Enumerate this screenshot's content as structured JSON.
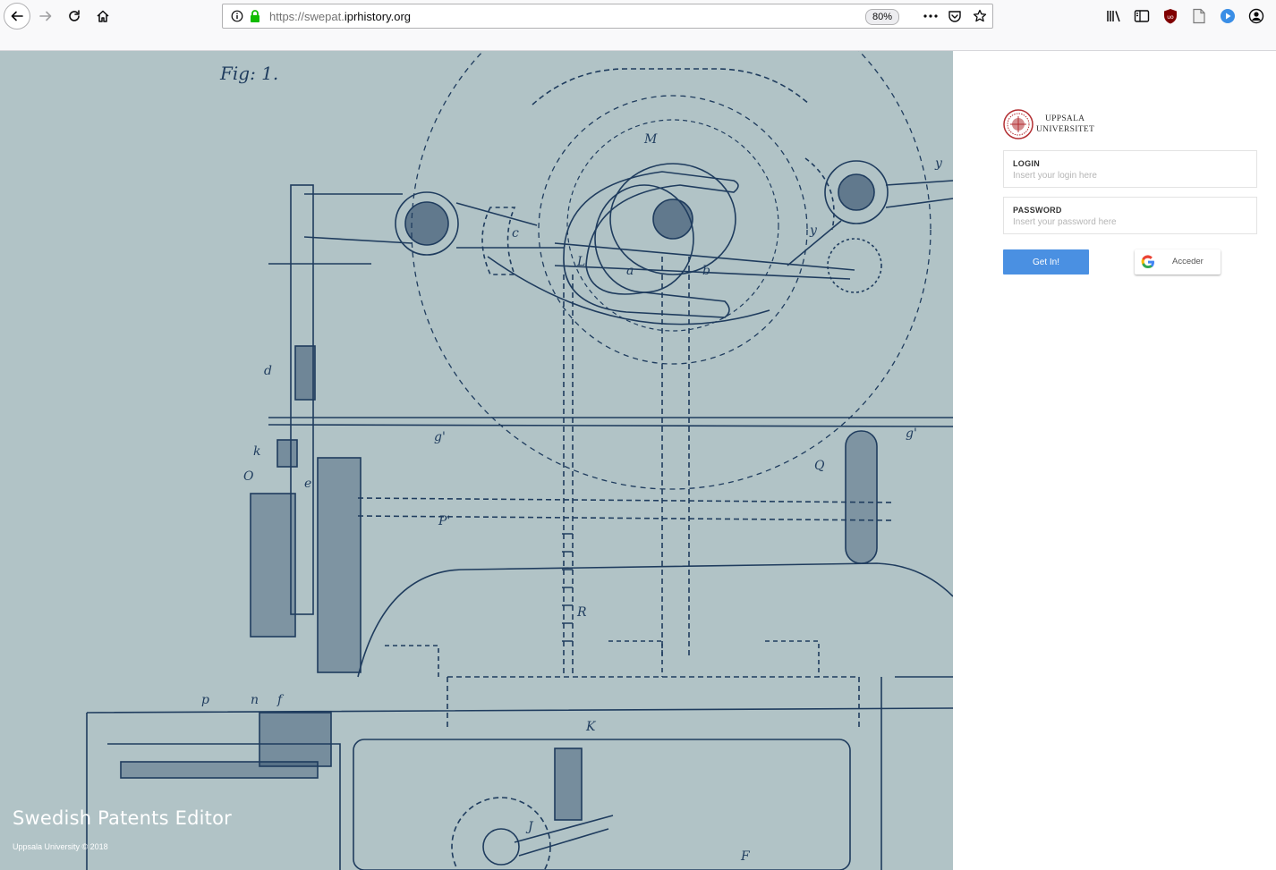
{
  "browser": {
    "url_prefix": "https://swepat.",
    "url_domain": "iprhistory.org",
    "zoom": "80%",
    "icons": [
      "back-arrow-icon",
      "forward-arrow-icon",
      "reload-icon",
      "home-icon",
      "info-icon",
      "lock-icon",
      "more-icon",
      "pocket-icon",
      "star-icon",
      "library-icon",
      "sidebar-icon",
      "ublock-icon",
      "reader-icon",
      "play-icon",
      "account-icon"
    ]
  },
  "hero": {
    "title": "Swedish Patents Editor",
    "copyright": "Uppsala University © 2018",
    "figure_label": "Fig: 1."
  },
  "login": {
    "logo_line1": "UPPSALA",
    "logo_line2": "UNIVERSITET",
    "login_label": "LOGIN",
    "login_placeholder": "Insert your login here",
    "password_label": "PASSWORD",
    "password_placeholder": "Insert your password here",
    "submit_label": "Get In!",
    "google_label": "Acceder"
  },
  "colors": {
    "hero_bg": "#b1c3c6",
    "drawing_ink": "#1f3c5e",
    "primary_button": "#4a90e2",
    "logo_red": "#b32f33"
  }
}
